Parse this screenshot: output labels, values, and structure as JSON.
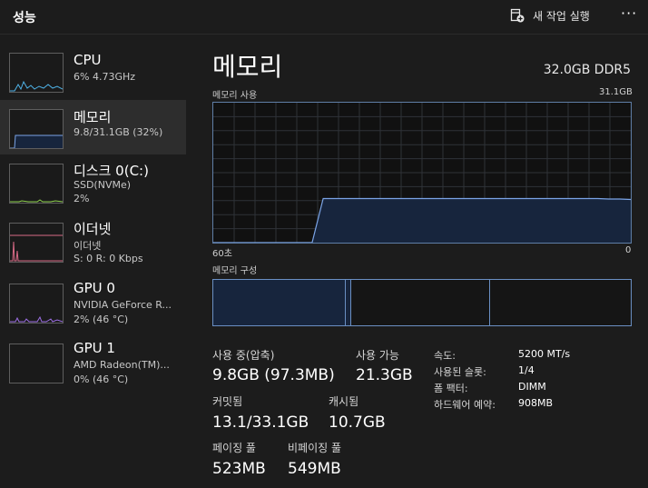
{
  "header": {
    "title": "성능",
    "new_task_label": "새 작업 실행",
    "more_label": "···"
  },
  "sidebar": {
    "items": [
      {
        "name": "CPU",
        "line1": "6% 4.73GHz",
        "line2": "",
        "color": "#4fb3e8"
      },
      {
        "name": "메모리",
        "line1": "9.8/31.1GB (32%)",
        "line2": "",
        "color": "#7ba4e6"
      },
      {
        "name": "디스크 0(C:)",
        "line1": "SSD(NVMe)",
        "line2": "2%",
        "color": "#8fd14f"
      },
      {
        "name": "이더넷",
        "line1": "이더넷",
        "line2": "S: 0 R: 0 Kbps",
        "color": "#d86a86"
      },
      {
        "name": "GPU 0",
        "line1": "NVIDIA GeForce R...",
        "line2": "2% (46 °C)",
        "color": "#9d6fe6"
      },
      {
        "name": "GPU 1",
        "line1": "AMD Radeon(TM)...",
        "line2": "0% (46 °C)",
        "color": "#9d6fe6"
      }
    ]
  },
  "main": {
    "title": "메모리",
    "spec": "32.0GB DDR5",
    "usage_label": "메모리 사용",
    "usage_max": "31.1GB",
    "axis_left": "60초",
    "axis_right": "0",
    "composition_label": "메모리 구성"
  },
  "chart_data": {
    "type": "area",
    "ylim": [
      0,
      31.1
    ],
    "points": [
      0,
      0,
      0,
      0,
      0,
      0,
      0,
      0,
      0,
      0,
      9.8,
      9.8,
      9.8,
      9.8,
      9.8,
      9.8,
      9.8,
      9.8,
      9.8,
      9.8,
      9.8,
      9.8,
      9.8,
      9.8,
      9.8,
      9.8,
      9.8,
      9.8,
      9.8,
      9.8,
      9.8,
      9.8,
      9.8,
      9.8,
      9.8,
      9.8,
      9.7,
      9.7,
      9.6
    ]
  },
  "stats": {
    "in_use_label": "사용 중(압축)",
    "in_use_value": "9.8GB (97.3MB)",
    "available_label": "사용 가능",
    "available_value": "21.3GB",
    "committed_label": "커밋됨",
    "committed_value": "13.1/33.1GB",
    "cached_label": "캐시됨",
    "cached_value": "10.7GB",
    "paged_label": "페이징 풀",
    "paged_value": "523MB",
    "nonpaged_label": "비페이징 풀",
    "nonpaged_value": "549MB"
  },
  "specs": [
    {
      "label": "속도:",
      "value": "5200 MT/s"
    },
    {
      "label": "사용된 슬롯:",
      "value": "1/4"
    },
    {
      "label": "폼 팩터:",
      "value": "DIMM"
    },
    {
      "label": "하드웨어 예약:",
      "value": "908MB"
    }
  ],
  "colors": {
    "background": "#1c1c1c",
    "selected": "#2d2d2d",
    "memory_line": "#7ba4e6",
    "memory_fill": "#17253d"
  }
}
